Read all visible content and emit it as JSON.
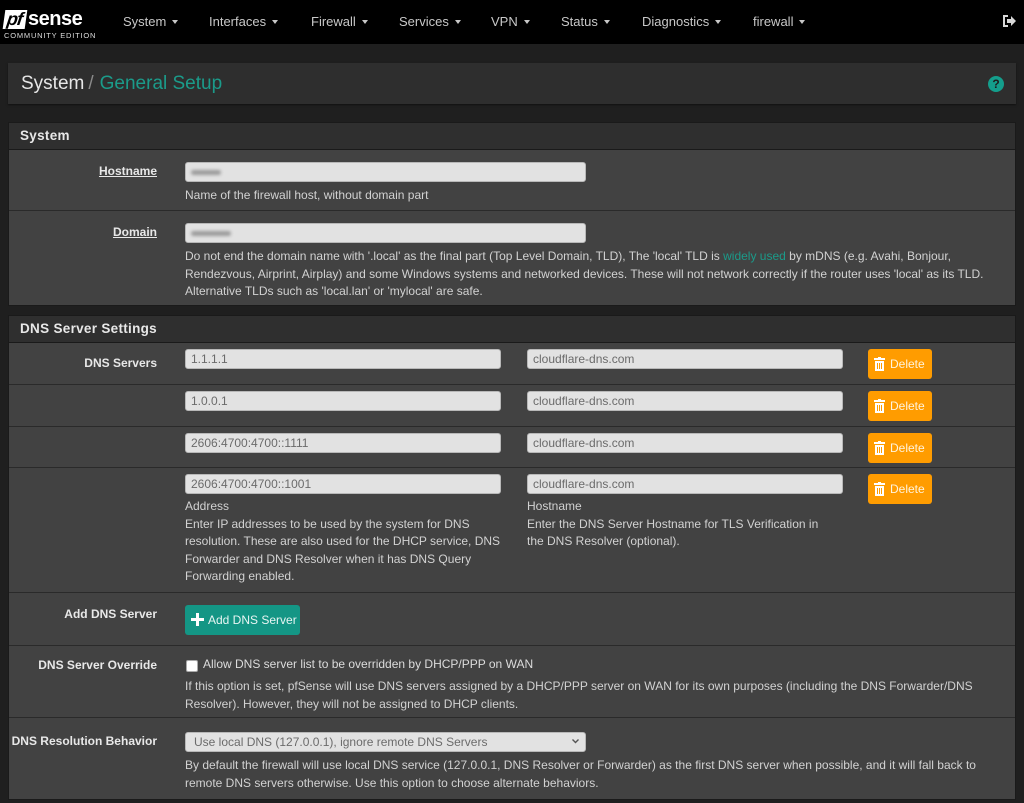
{
  "brand": {
    "logo_box": "pf",
    "logo_word": "sense",
    "edition": "COMMUNITY EDITION"
  },
  "nav": {
    "items": [
      {
        "label": "System"
      },
      {
        "label": "Interfaces"
      },
      {
        "label": "Firewall"
      },
      {
        "label": "Services"
      },
      {
        "label": "VPN"
      },
      {
        "label": "Status"
      },
      {
        "label": "Diagnostics"
      },
      {
        "label": "firewall"
      }
    ],
    "logout_icon": "sign-out-icon"
  },
  "breadcrumb": {
    "parent": "System",
    "separator": "/",
    "current": "General Setup",
    "help_icon": "?"
  },
  "system_panel": {
    "title": "System",
    "hostname": {
      "label": "Hostname",
      "value": "(redacted)",
      "help": "Name of the firewall host, without domain part"
    },
    "domain": {
      "label": "Domain",
      "value": "(redacted)",
      "help_before_link": "Do not end the domain name with '.local' as the final part (Top Level Domain, TLD), The 'local' TLD is ",
      "help_link": "widely used",
      "help_after_link": " by mDNS (e.g. Avahi, Bonjour, Rendezvous, Airprint, Airplay) and some Windows systems and networked devices. These will not network correctly if the router uses 'local' as its TLD. Alternative TLDs such as 'local.lan' or 'mylocal' are safe."
    }
  },
  "dns_panel": {
    "title": "DNS Server Settings",
    "servers_label": "DNS Servers",
    "servers": [
      {
        "address": "1.1.1.1",
        "hostname": "cloudflare-dns.com",
        "delete_label": "Delete"
      },
      {
        "address": "1.0.0.1",
        "hostname": "cloudflare-dns.com",
        "delete_label": "Delete"
      },
      {
        "address": "2606:4700:4700::1111",
        "hostname": "cloudflare-dns.com",
        "delete_label": "Delete"
      },
      {
        "address": "2606:4700:4700::1001",
        "hostname": "cloudflare-dns.com",
        "delete_label": "Delete"
      }
    ],
    "address_caption": "Address",
    "address_help": "Enter IP addresses to be used by the system for DNS resolution. These are also used for the DHCP service, DNS Forwarder and DNS Resolver when it has DNS Query Forwarding enabled.",
    "hostname_caption": "Hostname",
    "hostname_help": "Enter the DNS Server Hostname for TLS Verification in the DNS Resolver (optional).",
    "add": {
      "label": "Add DNS Server",
      "button_label": "Add DNS Server"
    },
    "override": {
      "label": "DNS Server Override",
      "checkbox_label": "Allow DNS server list to be overridden by DHCP/PPP on WAN",
      "checked": false,
      "help": "If this option is set, pfSense will use DNS servers assigned by a DHCP/PPP server on WAN for its own purposes (including the DNS Forwarder/DNS Resolver). However, they will not be assigned to DHCP clients."
    },
    "resolution": {
      "label": "DNS Resolution Behavior",
      "selected": "Use local DNS (127.0.0.1), ignore remote DNS Servers",
      "help": "By default the firewall will use local DNS service (127.0.0.1, DNS Resolver or Forwarder) as the first DNS server when possible, and it will fall back to remote DNS servers otherwise. Use this option to choose alternate behaviors."
    }
  },
  "colors": {
    "accent": "#1b9b8a",
    "delete": "#ff9c00",
    "add": "#149685",
    "navbar": "#000000",
    "panel": "#424242"
  }
}
